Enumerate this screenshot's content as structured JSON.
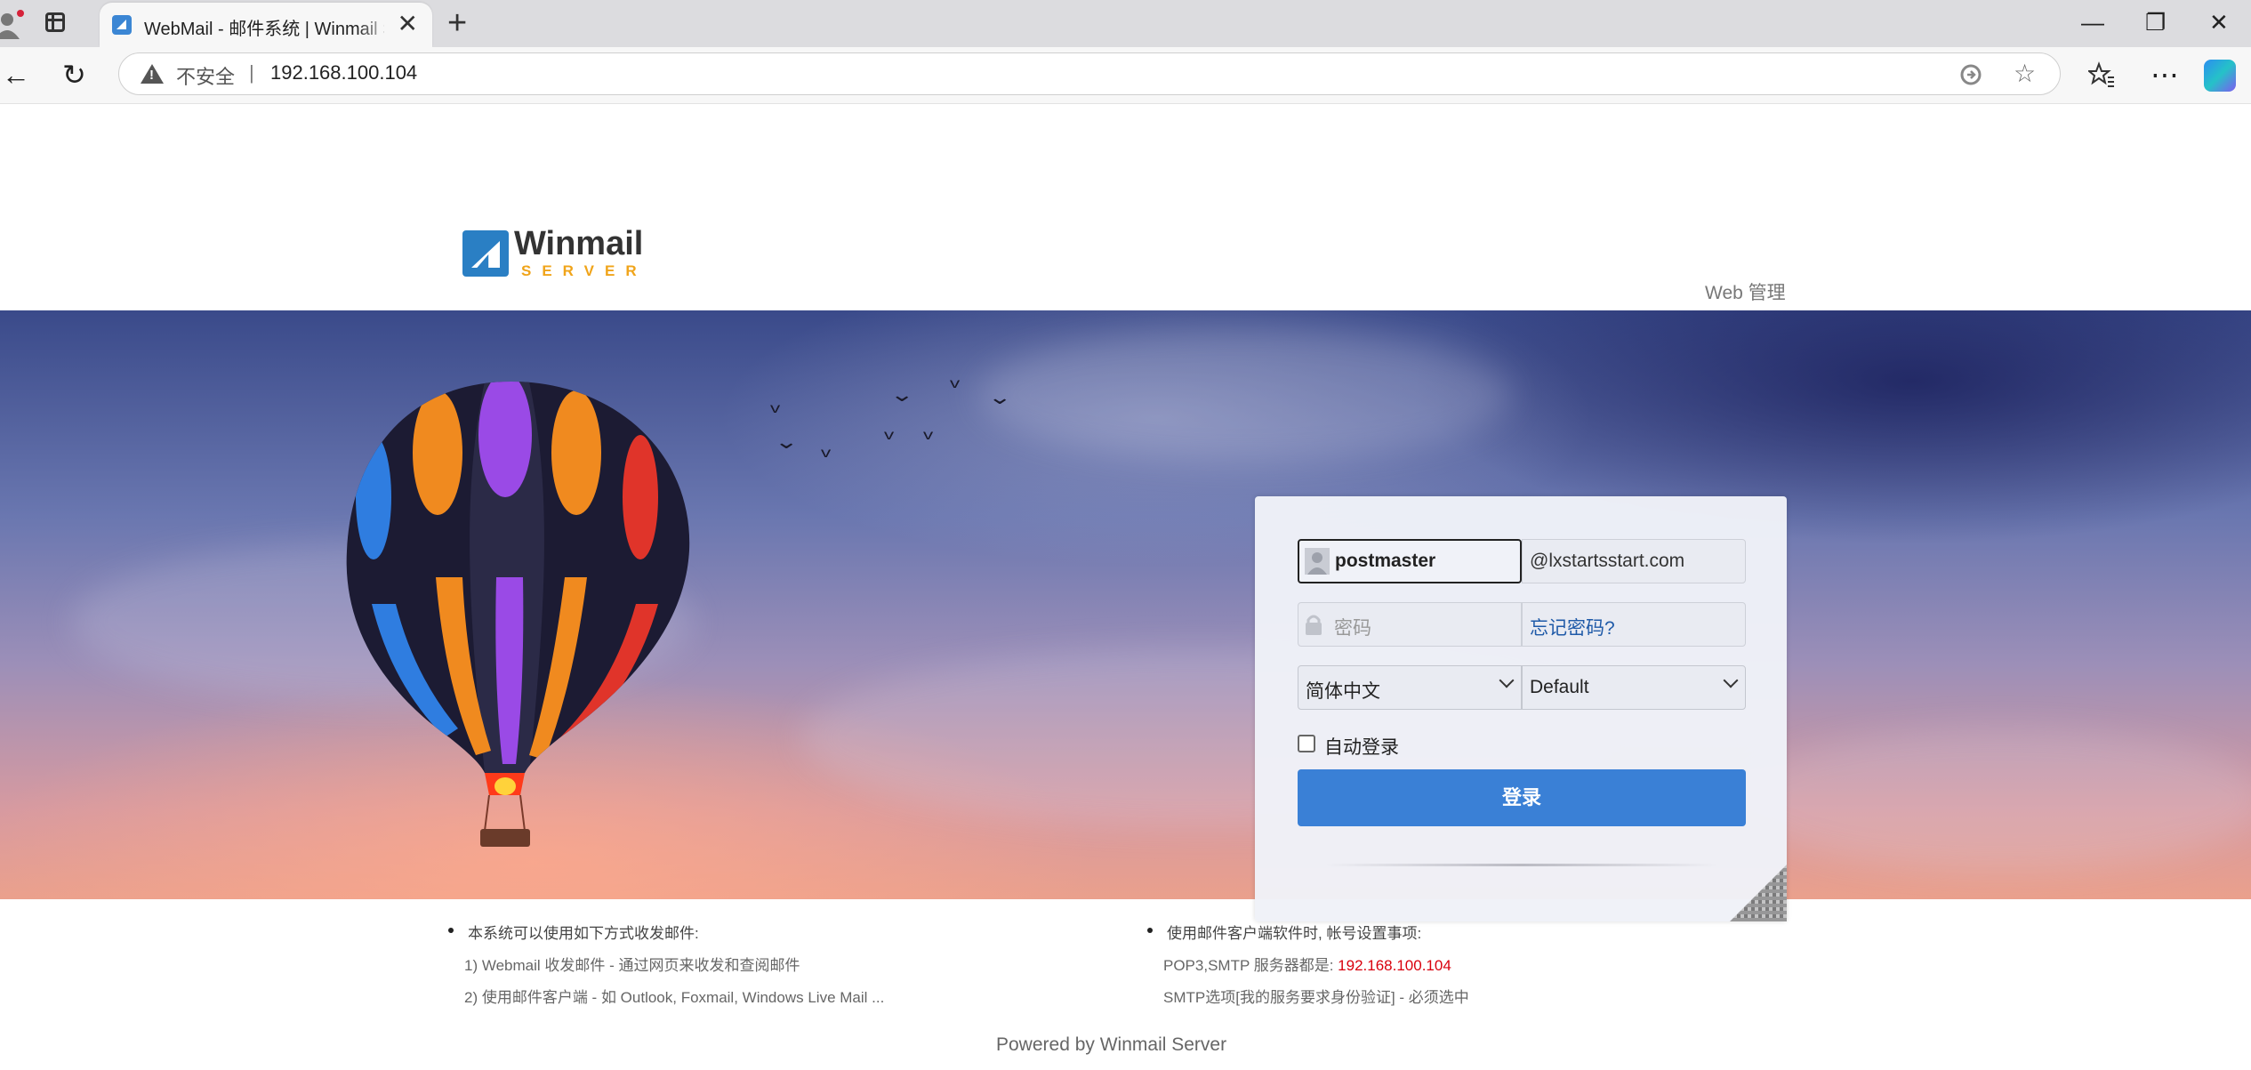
{
  "browser": {
    "tab_title": "WebMail - 邮件系统 | Winmail Server",
    "tab_close": "✕",
    "new_tab": "+",
    "security_label": "不安全",
    "address_separator": "|",
    "url": "192.168.100.104",
    "window_controls": {
      "minimize": "—",
      "restore": "❐",
      "close": "✕"
    },
    "nav_icons": {
      "back": "←",
      "reload": "↻",
      "favorites": "☆",
      "collections": "⭐",
      "more": "⋯"
    }
  },
  "header": {
    "logo_text": "Winmail",
    "logo_sub": "SERVER",
    "web_admin_link": "Web 管理"
  },
  "login": {
    "username_value": "postmaster",
    "domain_value": "@lxstartsstart.com",
    "password_placeholder": "密码",
    "forgot_password_link": "忘记密码?",
    "language_select": "简体中文",
    "skin_select": "Default",
    "auto_login_label": "自动登录",
    "auto_login_checked": false,
    "submit_label": "登录"
  },
  "info": {
    "left": {
      "title": "本系统可以使用如下方式收发邮件:",
      "line1": "1) Webmail 收发邮件 - 通过网页来收发和查阅邮件",
      "line2": "2) 使用邮件客户端 - 如 Outlook, Foxmail, Windows Live Mail ..."
    },
    "right": {
      "title": "使用邮件客户端软件时, 帐号设置事项:",
      "line1_prefix": "POP3,SMTP 服务器都是: ",
      "line1_ip": "192.168.100.104",
      "line2": "SMTP选项[我的服务要求身份验证] - 必须选中"
    },
    "powered_by": "Powered by Winmail Server"
  },
  "colors": {
    "accent_button": "#3a80d6",
    "link": "#1f5aa8",
    "ip_highlight": "#d9000d",
    "logo_blue": "#2a7fc4",
    "logo_orange": "#f0a41a"
  }
}
